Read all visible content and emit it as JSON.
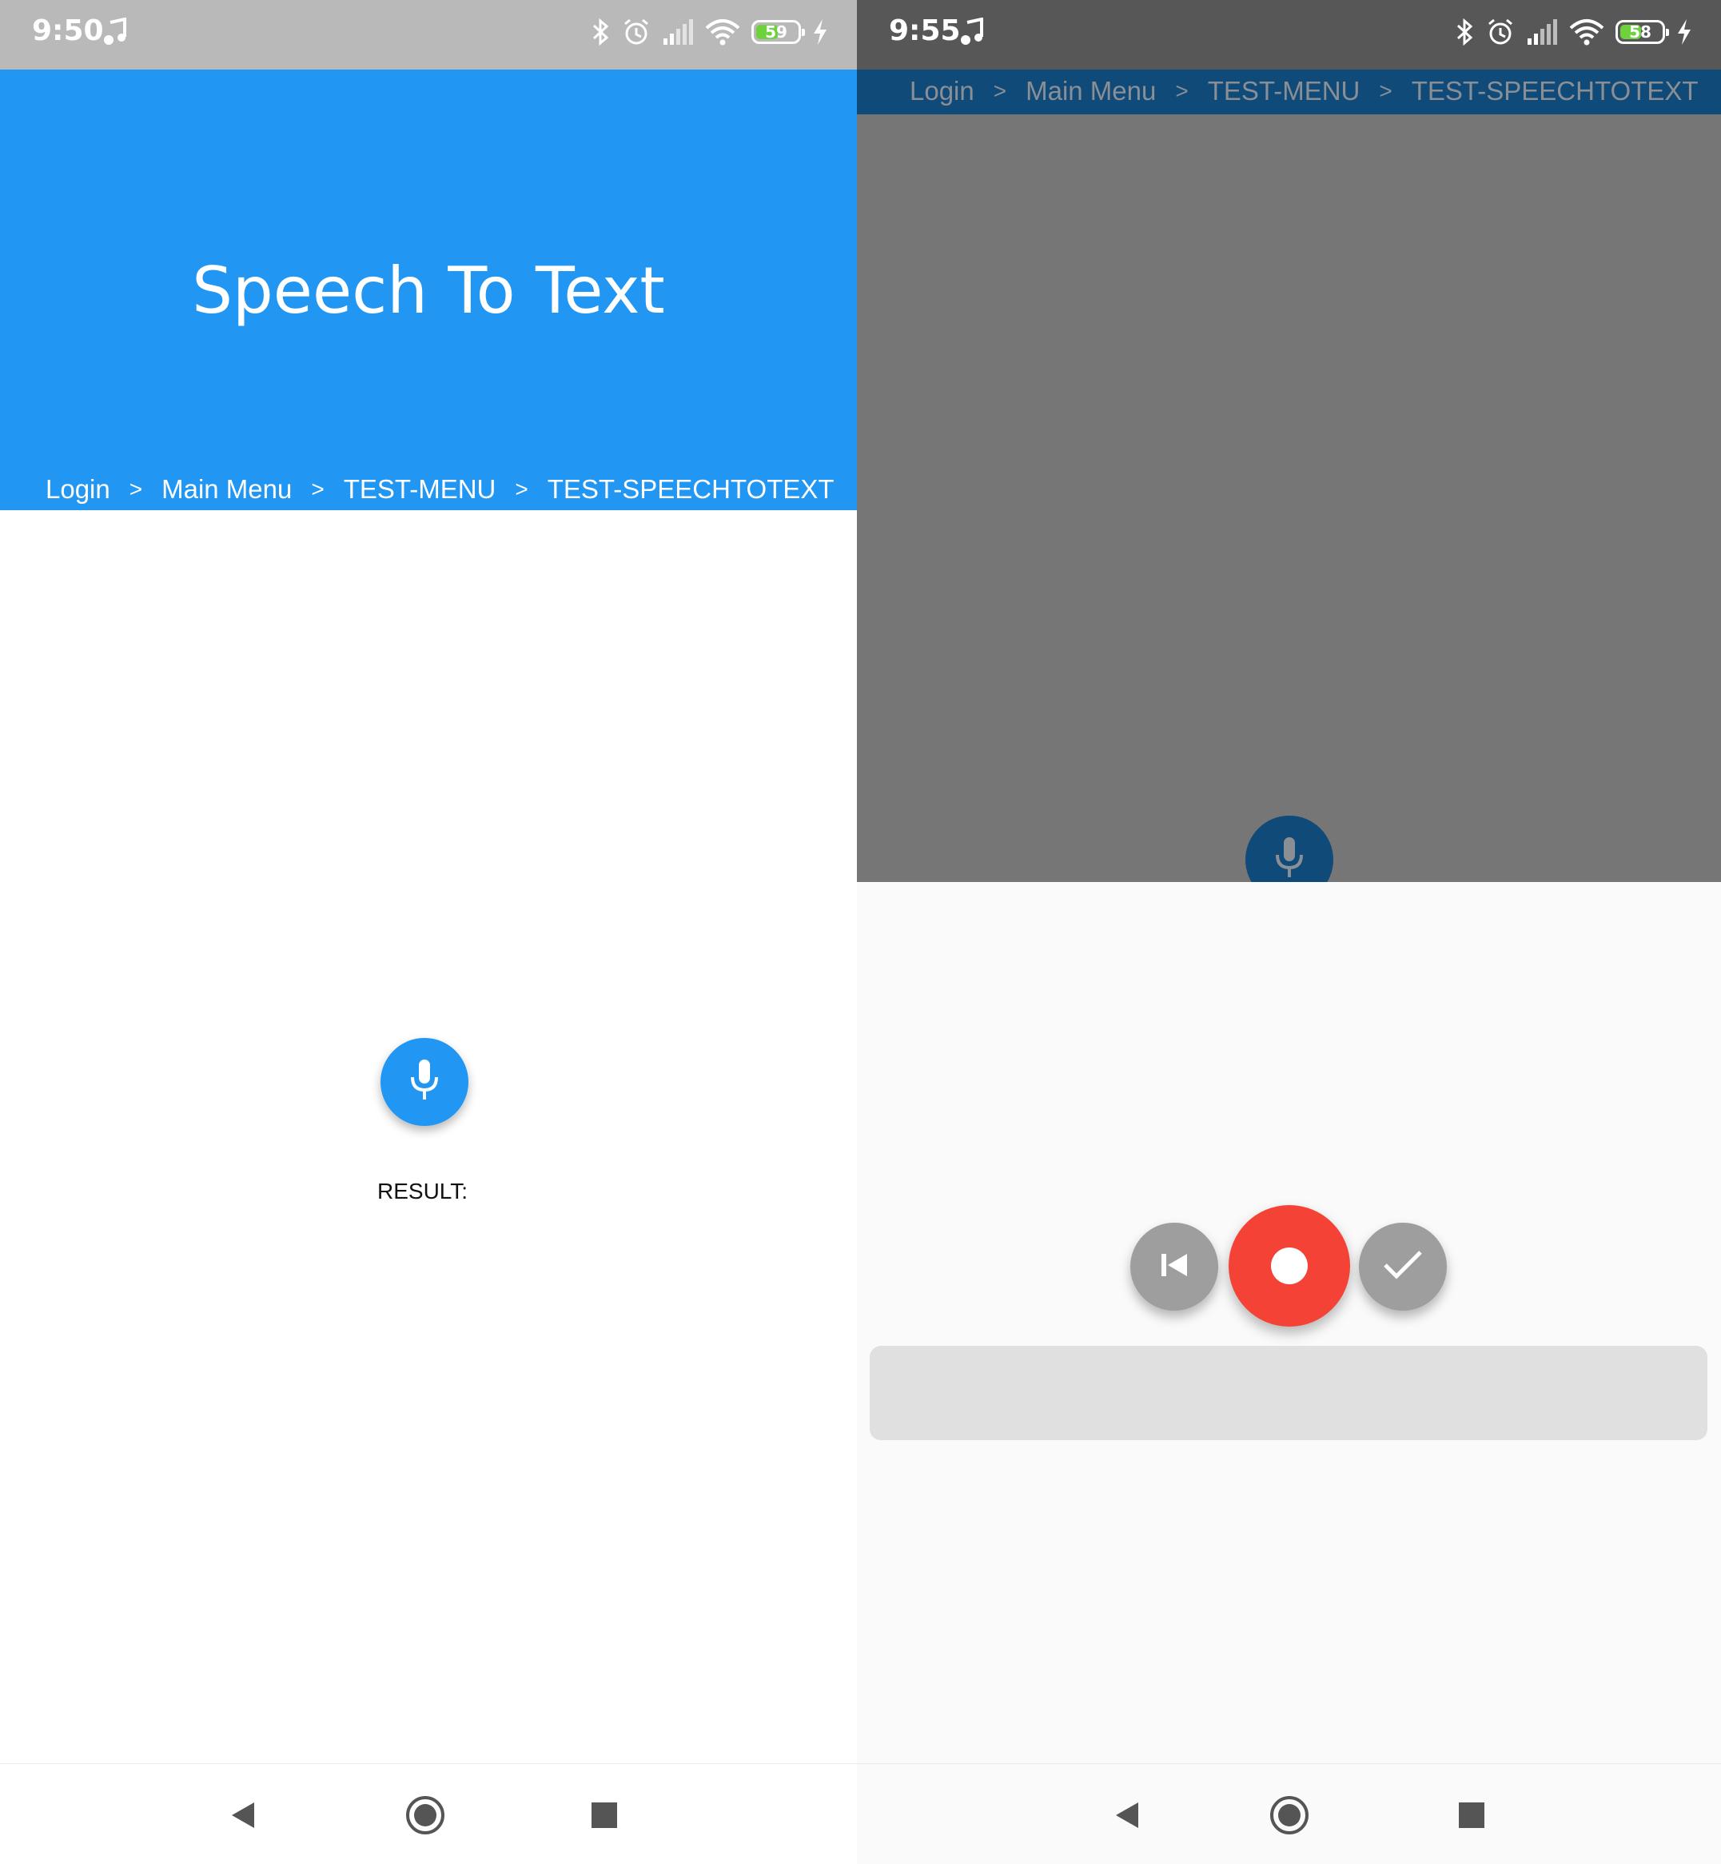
{
  "left_screen": {
    "status_bar": {
      "time": "9:50",
      "battery": "59",
      "battery_level": 0.59
    },
    "header": {
      "title": "Speech To Text"
    },
    "breadcrumb": [
      "Login",
      "Main Menu",
      "TEST-MENU",
      "TEST-SPEECHTOTEXT"
    ],
    "breadcrumb_separator": ">",
    "result_label": "RESULT:"
  },
  "right_screen": {
    "status_bar": {
      "time": "9:55",
      "battery": "58",
      "battery_level": 0.58
    },
    "breadcrumb": [
      "Login",
      "Main Menu",
      "TEST-MENU",
      "TEST-SPEECHTOTEXT"
    ],
    "breadcrumb_separator": ">",
    "result_text": ""
  },
  "icons": {
    "status": [
      "music-note-icon",
      "bluetooth-icon",
      "alarm-icon",
      "signal-icon",
      "wifi-icon",
      "battery-icon",
      "charging-icon"
    ],
    "actions": [
      "mic-icon",
      "skip-previous-icon",
      "record-icon",
      "check-icon"
    ],
    "nav": [
      "back-icon",
      "home-icon",
      "recents-icon"
    ]
  },
  "colors": {
    "primary": "#2196f3",
    "primary_dimmed": "#0f4a79",
    "record": "#f44336",
    "secondary_button": "#9e9e9e",
    "scrim": "#767676"
  }
}
